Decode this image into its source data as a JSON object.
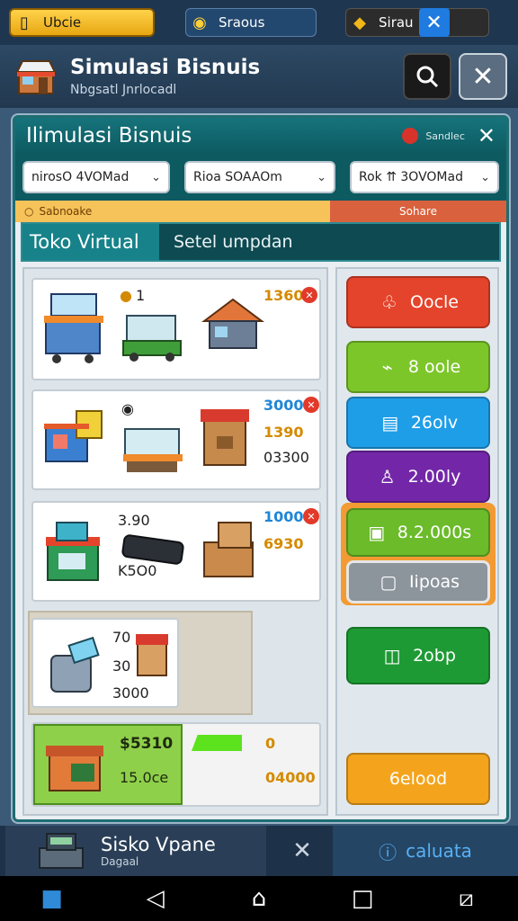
{
  "status_bar": {
    "gold_label": "Ubcie",
    "gems_label": "Sraous",
    "energy_label": "Sirau"
  },
  "header": {
    "title": "Simulasi Bisnuis",
    "subtitle": "Nbgsatl Jnrlocadl"
  },
  "panel": {
    "title": "Ilimulasi Bisnuis",
    "flag_label": "Sandlec",
    "filters": [
      {
        "label": "nirosO 4VOMad"
      },
      {
        "label": "Rioa  SOAAOm"
      },
      {
        "label": "Rok ⇈ 3OVOMad"
      }
    ],
    "tab_left": "Sabnoake",
    "tab_right": "Sohare",
    "store_name": "Toko Virtual",
    "store_field": "Setel umpdan"
  },
  "cards": [
    {
      "count": "1",
      "price": "1360"
    },
    {
      "price": "3000",
      "value_a": "1390",
      "value_b": "03300"
    },
    {
      "value_a": "3.90",
      "price": "1000",
      "value_b": "6930",
      "value_c": "K5O0"
    },
    {
      "value_a": "70",
      "value_b": "30",
      "value_c": "3000"
    },
    {
      "price": "$5310",
      "sub": "15.0ce",
      "value_a": "0",
      "value_b": "04000"
    }
  ],
  "actions": [
    {
      "label": "Oocle",
      "color": "#e4442b"
    },
    {
      "label": "8 oole",
      "color": "#7cc62a"
    },
    {
      "label": "26olv",
      "color": "#1f9ee8"
    },
    {
      "label": "2.00ly",
      "color": "#7327a8"
    },
    {
      "label": "8.2.000s",
      "color": "#6bbb2a"
    },
    {
      "label": "Iipoas",
      "color": "#8c949c"
    },
    {
      "label": "2obp",
      "color": "#1e9a34"
    },
    {
      "label": "6elood",
      "color": "#f4a41c"
    }
  ],
  "bottom_bar": {
    "title": "Sisko Vpane",
    "subtitle": "Dagaal",
    "right_label": "caluata"
  }
}
